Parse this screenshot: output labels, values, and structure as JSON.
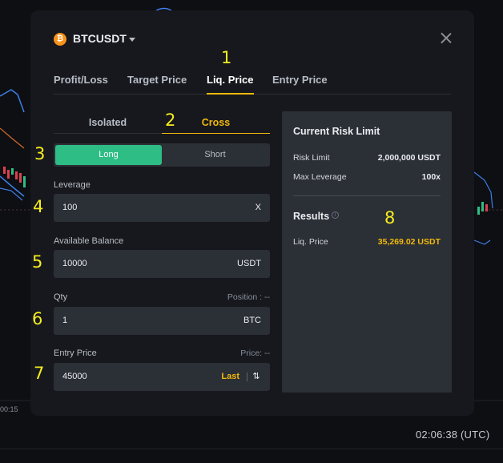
{
  "background": {
    "tick_label": "00:15",
    "time_readout": "02:06:38 (UTC)"
  },
  "header": {
    "coin_icon_glyph": "₿",
    "symbol": "BTCUSDT"
  },
  "tabs": [
    {
      "label": "Profit/Loss"
    },
    {
      "label": "Target Price"
    },
    {
      "label": "Liq. Price",
      "active": true
    },
    {
      "label": "Entry Price"
    }
  ],
  "margin_mode": {
    "isolated": "Isolated",
    "cross": "Cross",
    "selected": "Cross"
  },
  "side": {
    "long": "Long",
    "short": "Short",
    "selected": "Long"
  },
  "fields": {
    "leverage": {
      "label": "Leverage",
      "value": "100",
      "unit": "X"
    },
    "balance": {
      "label": "Available Balance",
      "value": "10000",
      "unit": "USDT"
    },
    "qty": {
      "label": "Qty",
      "aux": "Position : --",
      "value": "1",
      "unit": "BTC"
    },
    "entry": {
      "label": "Entry Price",
      "aux": "Price: --",
      "value": "45000",
      "last": "Last",
      "swap_glyph": "⇅"
    }
  },
  "risk_panel": {
    "title": "Current Risk Limit",
    "risk_limit_label": "Risk Limit",
    "risk_limit_value": "2,000,000 USDT",
    "max_leverage_label": "Max Leverage",
    "max_leverage_value": "100x",
    "results_title": "Results",
    "info_glyph": "i",
    "liq_price_label": "Liq. Price",
    "liq_price_value": "35,269.02 USDT"
  },
  "markers": [
    "1",
    "2",
    "3",
    "4",
    "5",
    "6",
    "7",
    "8"
  ],
  "colors": {
    "accent": "#f0b90b",
    "long_green": "#2ebd85",
    "marker_yellow": "#f5ee1f",
    "modal_bg": "#17181d",
    "field_bg": "#2b2f36"
  }
}
